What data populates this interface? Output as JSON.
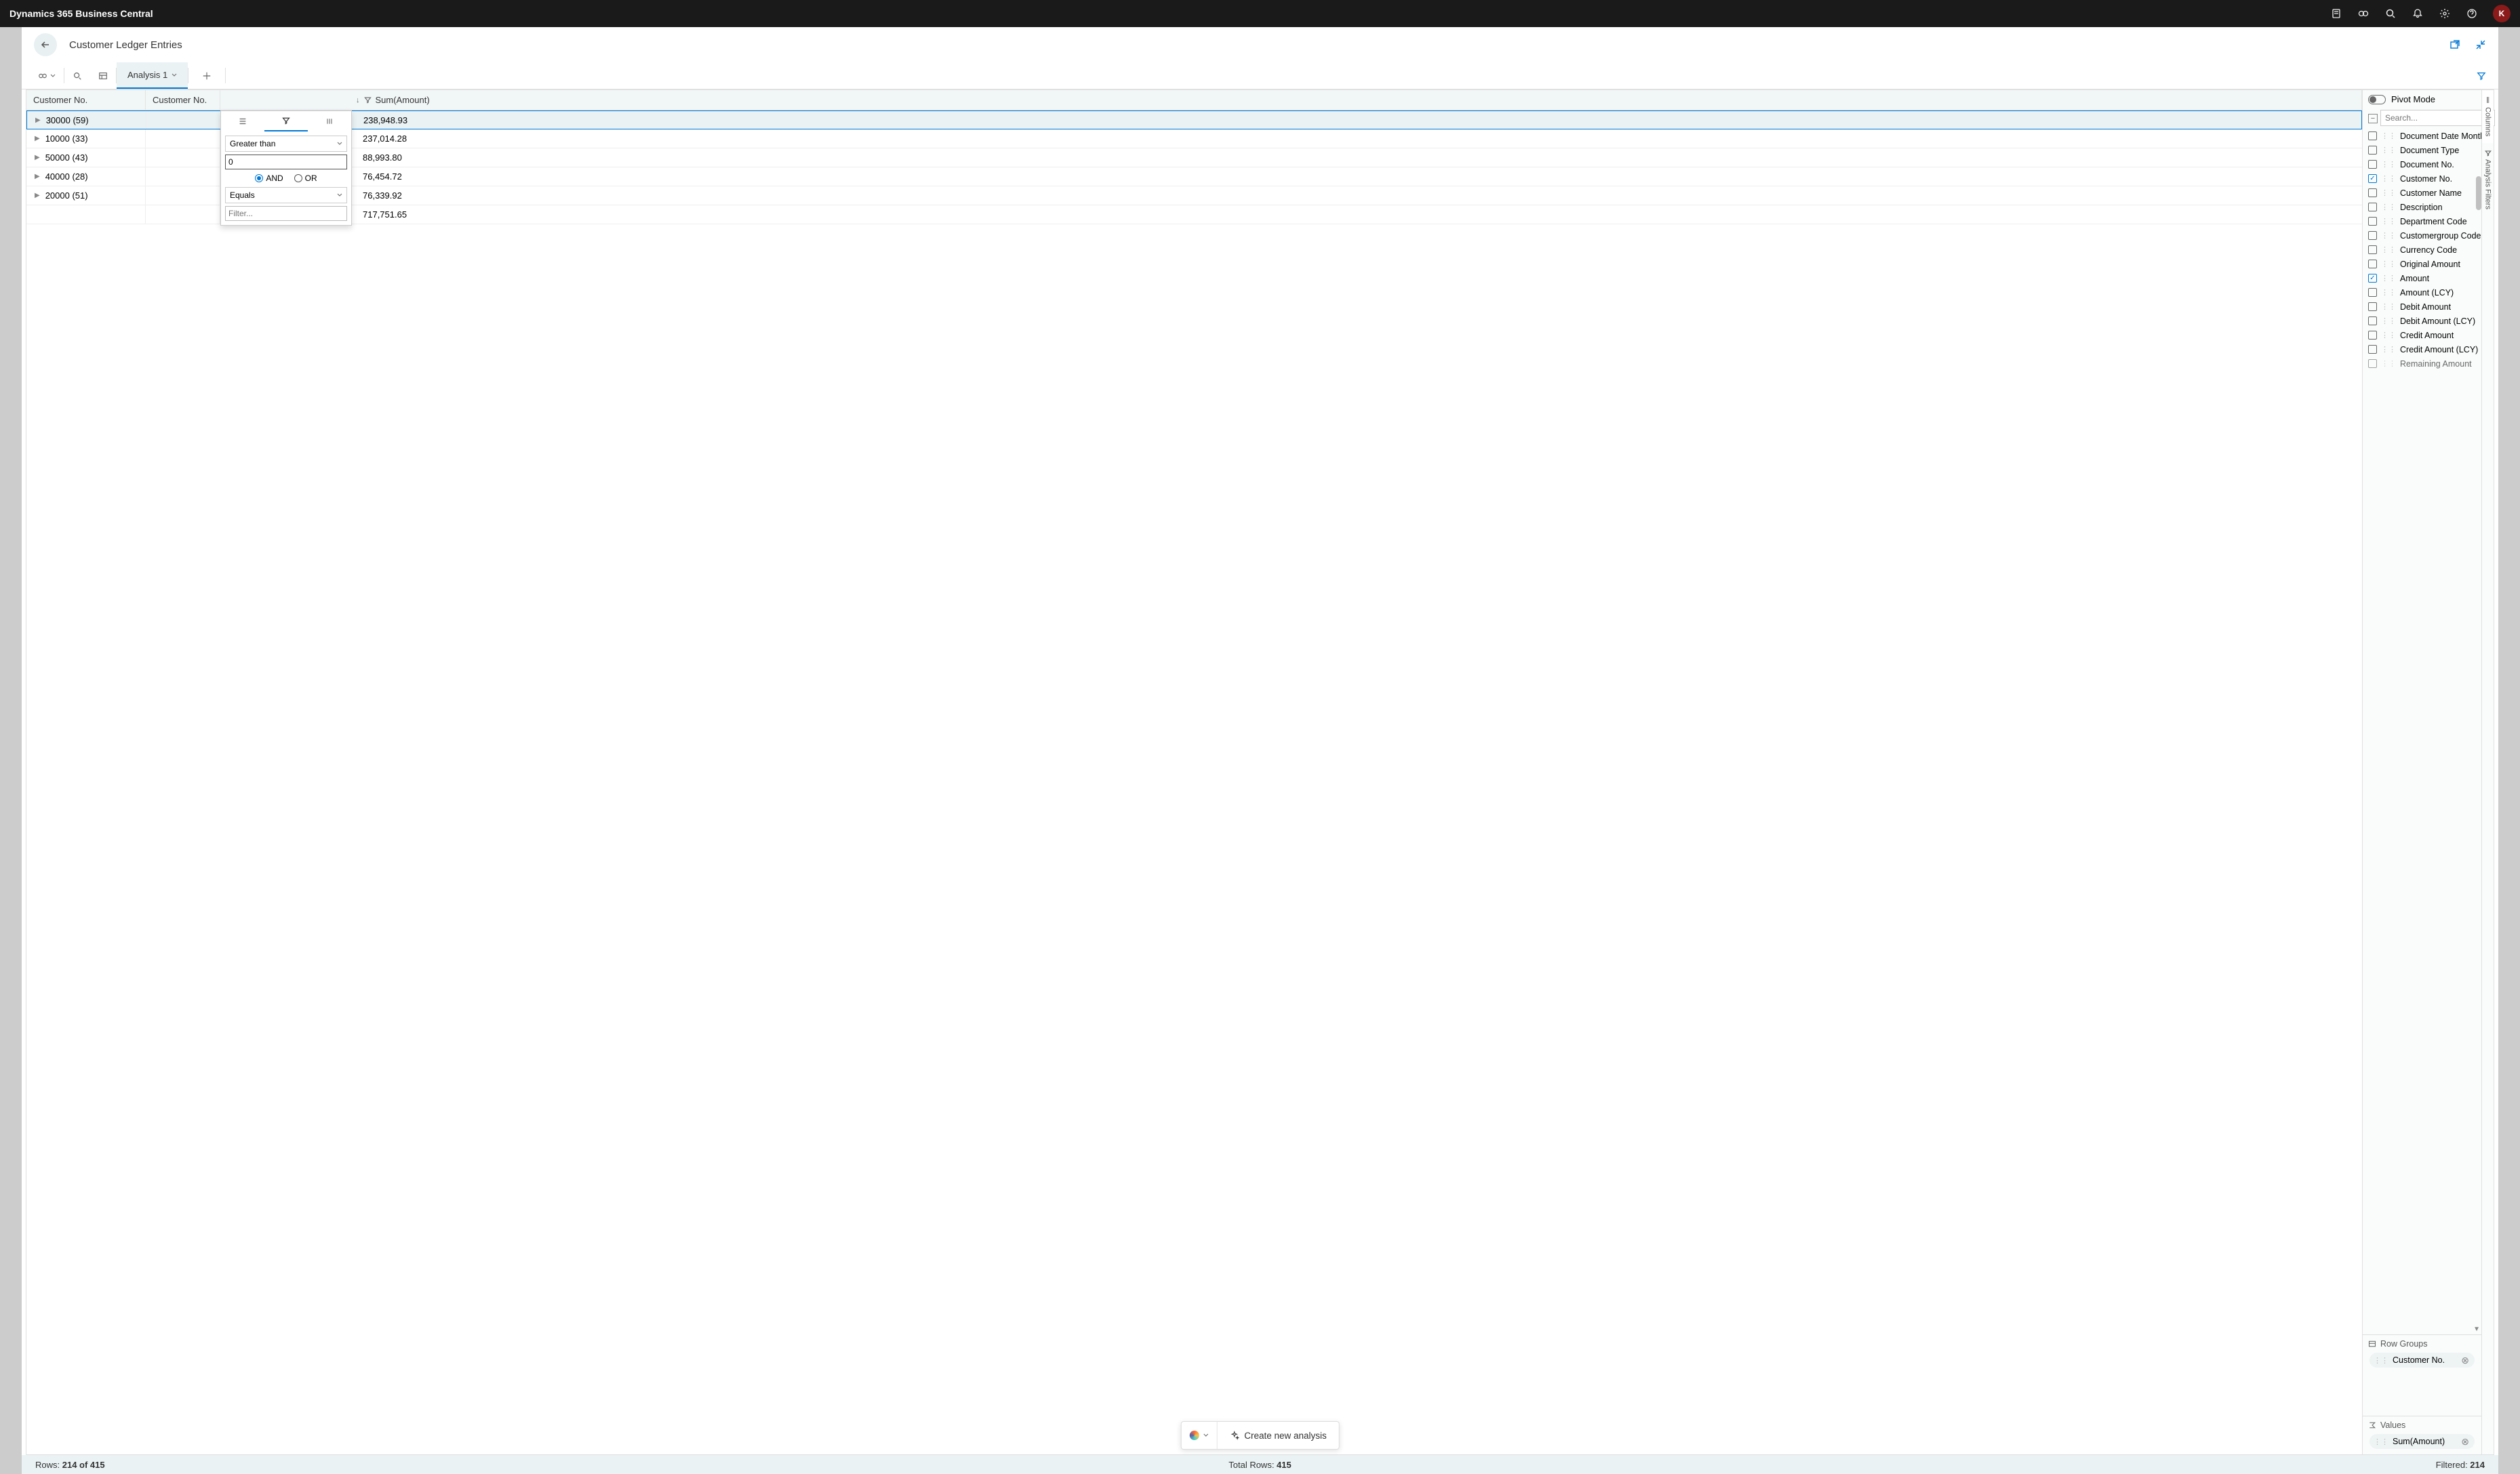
{
  "top": {
    "brand": "Dynamics 365 Business Central",
    "avatar": "K"
  },
  "page": {
    "title": "Customer Ledger Entries"
  },
  "toolbar": {
    "active_tab": "Analysis 1"
  },
  "grid": {
    "header": {
      "group_col": "Customer No.",
      "cust_col": "Customer No.",
      "amount_col": "Sum(Amount)"
    },
    "rows": [
      {
        "label": "30000 (59)",
        "amount": "238,948.93"
      },
      {
        "label": "10000 (33)",
        "amount": "237,014.28"
      },
      {
        "label": "50000 (43)",
        "amount": "88,993.80"
      },
      {
        "label": "40000 (28)",
        "amount": "76,454.72"
      },
      {
        "label": "20000 (51)",
        "amount": "76,339.92"
      }
    ],
    "total_amount": "717,751.65"
  },
  "filter_popup": {
    "op1": "Greater than",
    "val1": "0",
    "and_label": "AND",
    "or_label": "OR",
    "op2": "Equals",
    "val2_placeholder": "Filter..."
  },
  "side_panel": {
    "pivot_label": "Pivot Mode",
    "search_placeholder": "Search...",
    "fields": [
      {
        "label": "Document Date Month",
        "checked": false,
        "asc": true
      },
      {
        "label": "Document Type",
        "checked": false
      },
      {
        "label": "Document No.",
        "checked": false
      },
      {
        "label": "Customer No.",
        "checked": true
      },
      {
        "label": "Customer Name",
        "checked": false
      },
      {
        "label": "Description",
        "checked": false
      },
      {
        "label": "Department Code",
        "checked": false
      },
      {
        "label": "Customergroup Code",
        "checked": false
      },
      {
        "label": "Currency Code",
        "checked": false
      },
      {
        "label": "Original Amount",
        "checked": false
      },
      {
        "label": "Amount",
        "checked": true
      },
      {
        "label": "Amount (LCY)",
        "checked": false
      },
      {
        "label": "Debit Amount",
        "checked": false
      },
      {
        "label": "Debit Amount (LCY)",
        "checked": false
      },
      {
        "label": "Credit Amount",
        "checked": false
      },
      {
        "label": "Credit Amount (LCY)",
        "checked": false
      },
      {
        "label": "Remaining Amount",
        "checked": false
      }
    ],
    "row_groups_label": "Row Groups",
    "row_group_chip": "Customer No.",
    "values_label": "Values",
    "values_chip": "Sum(Amount)"
  },
  "side_tabs": {
    "columns": "Columns",
    "filters": "Analysis Filters"
  },
  "action_bar": {
    "create": "Create new analysis"
  },
  "status": {
    "rows_label": "Rows: ",
    "rows_val": "214 of 415",
    "total_label": "Total Rows: ",
    "total_val": "415",
    "filtered_label": "Filtered: ",
    "filtered_val": "214"
  }
}
